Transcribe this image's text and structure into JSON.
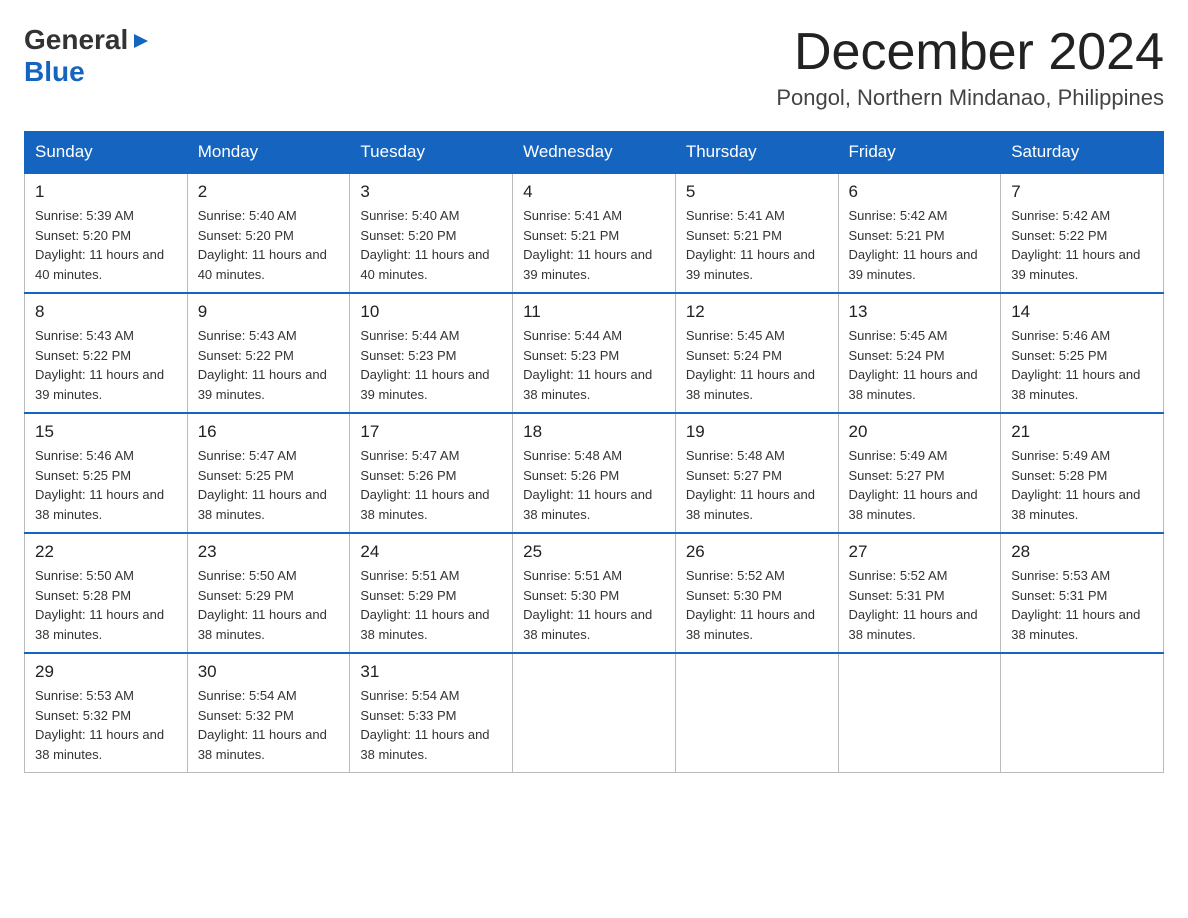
{
  "header": {
    "logo_line1": "General",
    "logo_triangle": "▶",
    "logo_line2": "Blue",
    "month_title": "December 2024",
    "location": "Pongol, Northern Mindanao, Philippines"
  },
  "weekdays": [
    "Sunday",
    "Monday",
    "Tuesday",
    "Wednesday",
    "Thursday",
    "Friday",
    "Saturday"
  ],
  "weeks": [
    [
      {
        "day": "1",
        "sunrise": "5:39 AM",
        "sunset": "5:20 PM",
        "daylight": "11 hours and 40 minutes."
      },
      {
        "day": "2",
        "sunrise": "5:40 AM",
        "sunset": "5:20 PM",
        "daylight": "11 hours and 40 minutes."
      },
      {
        "day": "3",
        "sunrise": "5:40 AM",
        "sunset": "5:20 PM",
        "daylight": "11 hours and 40 minutes."
      },
      {
        "day": "4",
        "sunrise": "5:41 AM",
        "sunset": "5:21 PM",
        "daylight": "11 hours and 39 minutes."
      },
      {
        "day": "5",
        "sunrise": "5:41 AM",
        "sunset": "5:21 PM",
        "daylight": "11 hours and 39 minutes."
      },
      {
        "day": "6",
        "sunrise": "5:42 AM",
        "sunset": "5:21 PM",
        "daylight": "11 hours and 39 minutes."
      },
      {
        "day": "7",
        "sunrise": "5:42 AM",
        "sunset": "5:22 PM",
        "daylight": "11 hours and 39 minutes."
      }
    ],
    [
      {
        "day": "8",
        "sunrise": "5:43 AM",
        "sunset": "5:22 PM",
        "daylight": "11 hours and 39 minutes."
      },
      {
        "day": "9",
        "sunrise": "5:43 AM",
        "sunset": "5:22 PM",
        "daylight": "11 hours and 39 minutes."
      },
      {
        "day": "10",
        "sunrise": "5:44 AM",
        "sunset": "5:23 PM",
        "daylight": "11 hours and 39 minutes."
      },
      {
        "day": "11",
        "sunrise": "5:44 AM",
        "sunset": "5:23 PM",
        "daylight": "11 hours and 38 minutes."
      },
      {
        "day": "12",
        "sunrise": "5:45 AM",
        "sunset": "5:24 PM",
        "daylight": "11 hours and 38 minutes."
      },
      {
        "day": "13",
        "sunrise": "5:45 AM",
        "sunset": "5:24 PM",
        "daylight": "11 hours and 38 minutes."
      },
      {
        "day": "14",
        "sunrise": "5:46 AM",
        "sunset": "5:25 PM",
        "daylight": "11 hours and 38 minutes."
      }
    ],
    [
      {
        "day": "15",
        "sunrise": "5:46 AM",
        "sunset": "5:25 PM",
        "daylight": "11 hours and 38 minutes."
      },
      {
        "day": "16",
        "sunrise": "5:47 AM",
        "sunset": "5:25 PM",
        "daylight": "11 hours and 38 minutes."
      },
      {
        "day": "17",
        "sunrise": "5:47 AM",
        "sunset": "5:26 PM",
        "daylight": "11 hours and 38 minutes."
      },
      {
        "day": "18",
        "sunrise": "5:48 AM",
        "sunset": "5:26 PM",
        "daylight": "11 hours and 38 minutes."
      },
      {
        "day": "19",
        "sunrise": "5:48 AM",
        "sunset": "5:27 PM",
        "daylight": "11 hours and 38 minutes."
      },
      {
        "day": "20",
        "sunrise": "5:49 AM",
        "sunset": "5:27 PM",
        "daylight": "11 hours and 38 minutes."
      },
      {
        "day": "21",
        "sunrise": "5:49 AM",
        "sunset": "5:28 PM",
        "daylight": "11 hours and 38 minutes."
      }
    ],
    [
      {
        "day": "22",
        "sunrise": "5:50 AM",
        "sunset": "5:28 PM",
        "daylight": "11 hours and 38 minutes."
      },
      {
        "day": "23",
        "sunrise": "5:50 AM",
        "sunset": "5:29 PM",
        "daylight": "11 hours and 38 minutes."
      },
      {
        "day": "24",
        "sunrise": "5:51 AM",
        "sunset": "5:29 PM",
        "daylight": "11 hours and 38 minutes."
      },
      {
        "day": "25",
        "sunrise": "5:51 AM",
        "sunset": "5:30 PM",
        "daylight": "11 hours and 38 minutes."
      },
      {
        "day": "26",
        "sunrise": "5:52 AM",
        "sunset": "5:30 PM",
        "daylight": "11 hours and 38 minutes."
      },
      {
        "day": "27",
        "sunrise": "5:52 AM",
        "sunset": "5:31 PM",
        "daylight": "11 hours and 38 minutes."
      },
      {
        "day": "28",
        "sunrise": "5:53 AM",
        "sunset": "5:31 PM",
        "daylight": "11 hours and 38 minutes."
      }
    ],
    [
      {
        "day": "29",
        "sunrise": "5:53 AM",
        "sunset": "5:32 PM",
        "daylight": "11 hours and 38 minutes."
      },
      {
        "day": "30",
        "sunrise": "5:54 AM",
        "sunset": "5:32 PM",
        "daylight": "11 hours and 38 minutes."
      },
      {
        "day": "31",
        "sunrise": "5:54 AM",
        "sunset": "5:33 PM",
        "daylight": "11 hours and 38 minutes."
      },
      null,
      null,
      null,
      null
    ]
  ]
}
